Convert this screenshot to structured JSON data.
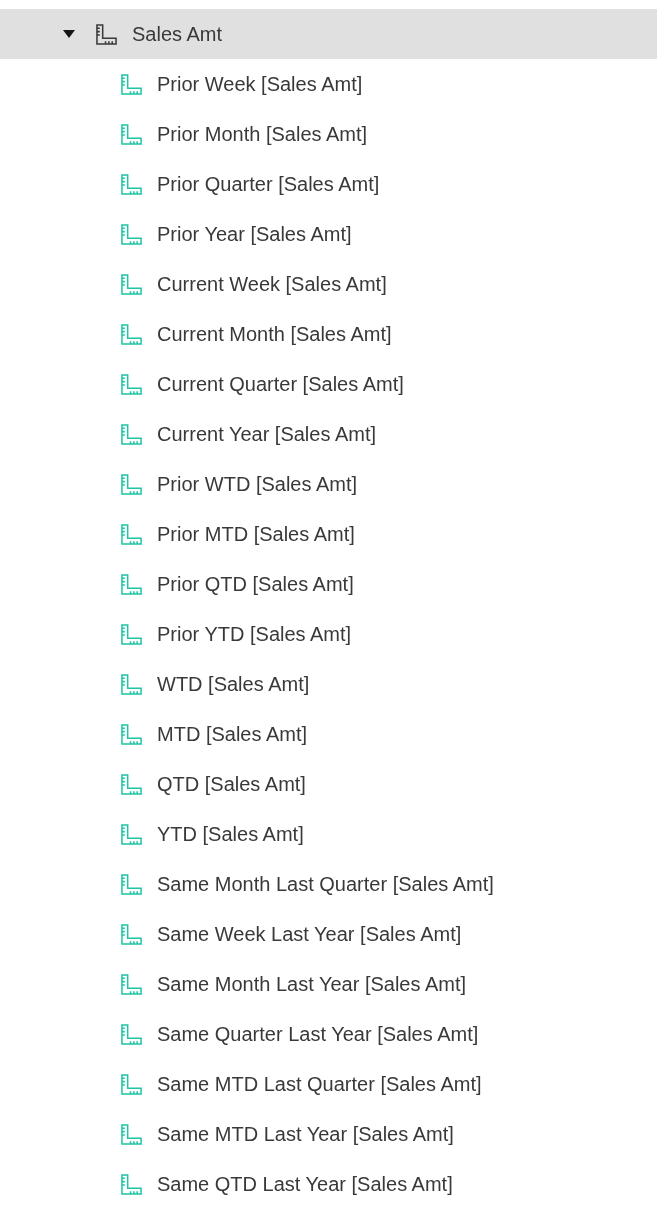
{
  "tree": {
    "label": "Sales Amt",
    "expanded": true,
    "selected": true,
    "children": [
      {
        "label": "Prior Week [Sales Amt]",
        "selected": false
      },
      {
        "label": "Prior Month [Sales Amt]",
        "selected": false
      },
      {
        "label": "Prior Quarter [Sales Amt]",
        "selected": false
      },
      {
        "label": "Prior Year [Sales Amt]",
        "selected": false
      },
      {
        "label": "Current Week [Sales Amt]",
        "selected": false
      },
      {
        "label": "Current Month [Sales Amt]",
        "selected": false
      },
      {
        "label": "Current Quarter [Sales Amt]",
        "selected": false
      },
      {
        "label": "Current Year [Sales Amt]",
        "selected": false
      },
      {
        "label": "Prior WTD [Sales Amt]",
        "selected": false
      },
      {
        "label": "Prior MTD [Sales Amt]",
        "selected": false
      },
      {
        "label": "Prior QTD [Sales Amt]",
        "selected": false
      },
      {
        "label": "Prior YTD [Sales Amt]",
        "selected": false
      },
      {
        "label": "WTD [Sales Amt]",
        "selected": false
      },
      {
        "label": "MTD [Sales Amt]",
        "selected": false
      },
      {
        "label": "QTD [Sales Amt]",
        "selected": false
      },
      {
        "label": "YTD [Sales Amt]",
        "selected": false
      },
      {
        "label": "Same Month Last Quarter [Sales Amt]",
        "selected": false
      },
      {
        "label": "Same Week Last Year [Sales Amt]",
        "selected": false
      },
      {
        "label": "Same Month Last Year [Sales Amt]",
        "selected": false
      },
      {
        "label": "Same Quarter Last Year [Sales Amt]",
        "selected": false
      },
      {
        "label": "Same MTD Last Quarter [Sales Amt]",
        "selected": false
      },
      {
        "label": "Same MTD Last Year [Sales Amt]",
        "selected": false
      },
      {
        "label": "Same QTD Last Year [Sales Amt]",
        "selected": false
      }
    ]
  }
}
